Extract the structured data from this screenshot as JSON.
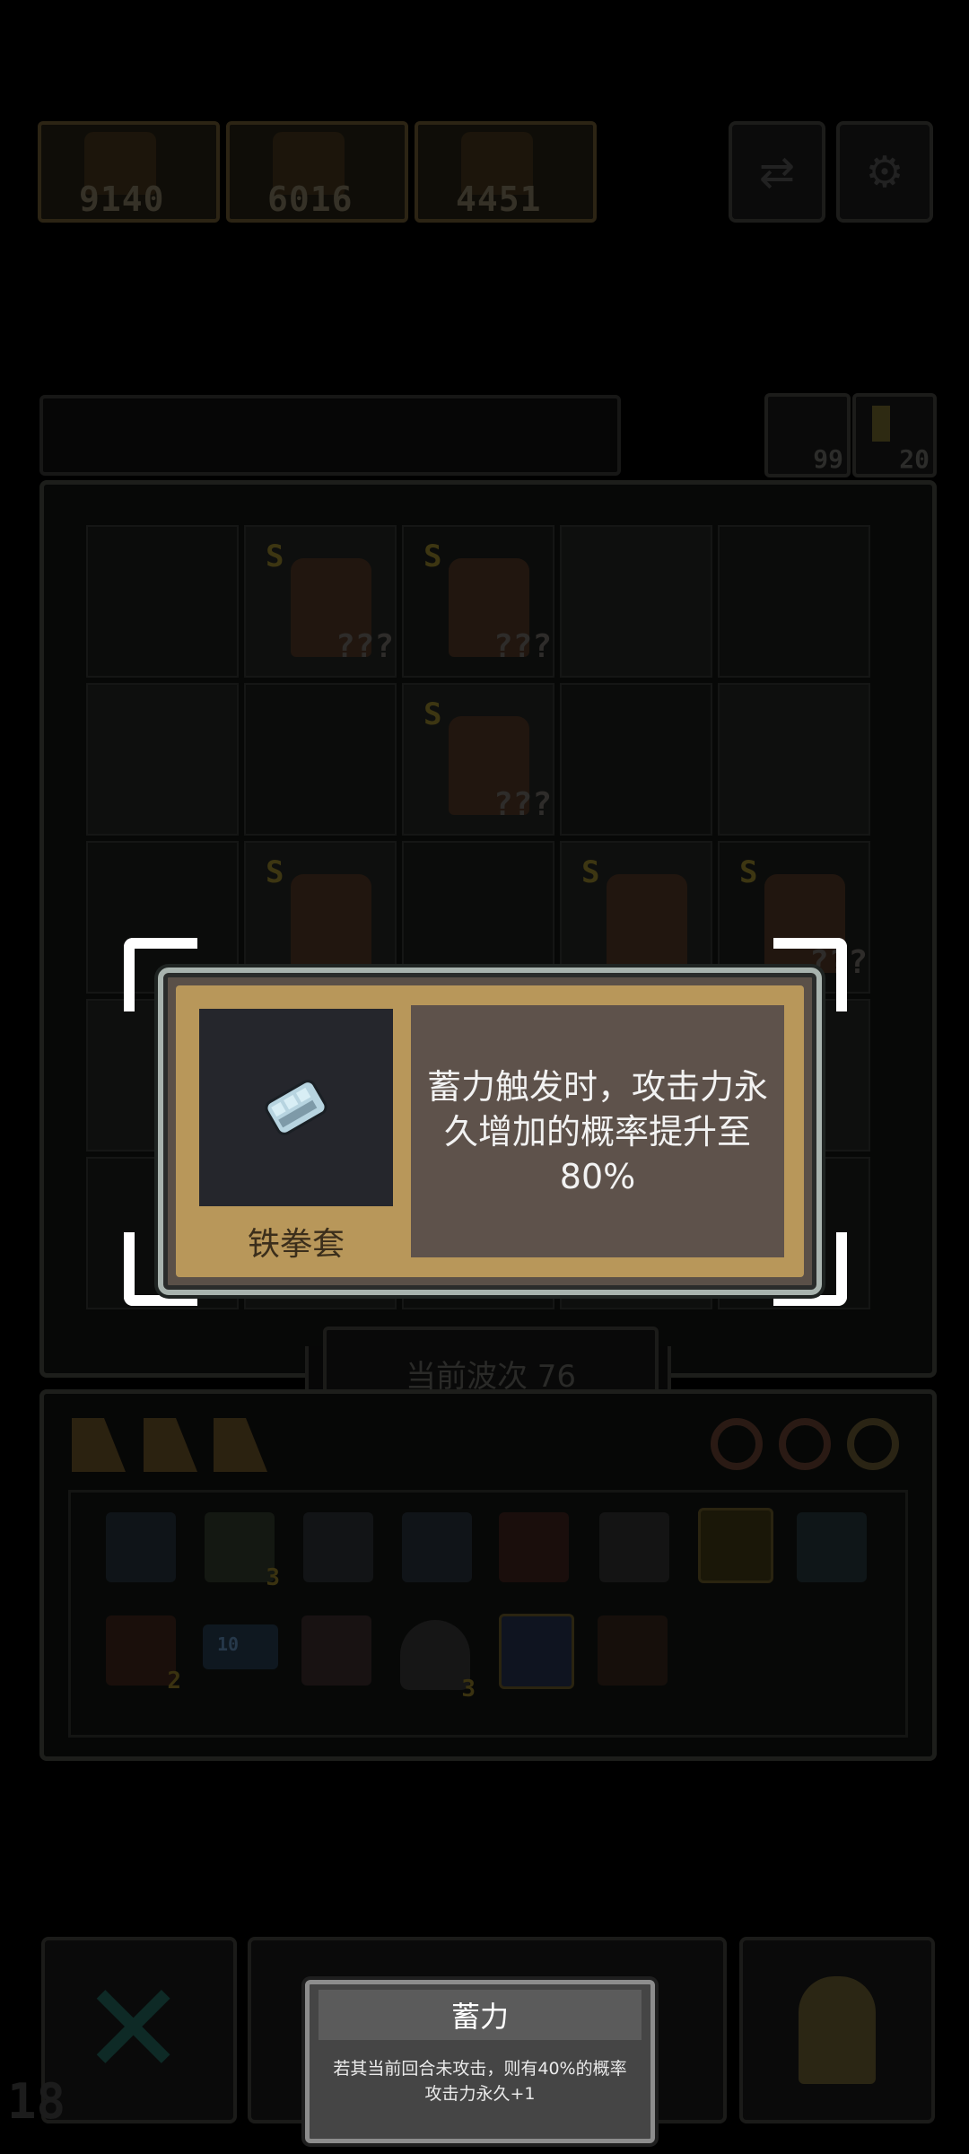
{
  "top_bar": {
    "heroes": [
      {
        "score": "9140"
      },
      {
        "score": "6016"
      },
      {
        "score": "4451"
      }
    ],
    "buttons": [
      {
        "icon": "swap-icon"
      },
      {
        "icon": "settings-icon"
      }
    ]
  },
  "resources": {
    "undo_count": "99",
    "energy_count": "20"
  },
  "board": {
    "units": [
      {
        "rank": "S",
        "level": "???"
      },
      {
        "rank": "S",
        "level": "???"
      },
      {
        "rank": "S",
        "level": "???"
      },
      {
        "rank": "S",
        "level": "???"
      },
      {
        "rank": "S",
        "level": "???"
      },
      {
        "rank": "S",
        "level": "???"
      }
    ]
  },
  "popup": {
    "item_name": "铁拳套",
    "description": "蓄力触发时，攻击力永久增加的概率提升至80%",
    "icon": "iron-fist-icon"
  },
  "wave": {
    "label": "当前波次 76"
  },
  "inventory": {
    "badges": [
      "3",
      "2",
      "3"
    ],
    "bottle_label": "10"
  },
  "tooltip": {
    "title": "蓄力",
    "text": "若其当前回合未攻击，则有40%的概率攻击力永久+1"
  },
  "player_level": "18"
}
